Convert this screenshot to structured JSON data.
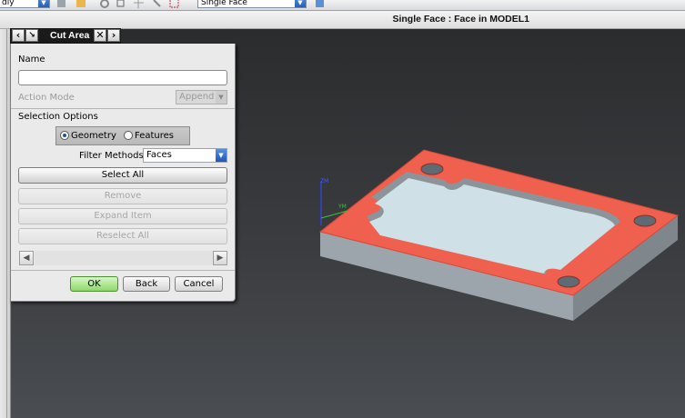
{
  "toolbar": {
    "left_combo_text": "dly",
    "selection_filter": "Single Face"
  },
  "viewport": {
    "title": "Single Face : Face in MODEL1"
  },
  "dialog": {
    "title": "Cut Area",
    "name_label": "Name",
    "name_value": "",
    "action_mode_label": "Action Mode",
    "action_mode_value": "Append",
    "selection_options_label": "Selection Options",
    "radio_geometry": "Geometry",
    "radio_features": "Features",
    "radio_selected": "Geometry",
    "filter_methods_label": "Filter Methods",
    "filter_methods_value": "Faces",
    "buttons": {
      "select_all": "Select All",
      "remove": "Remove",
      "expand_item": "Expand Item",
      "reselect_all": "Reselect All"
    },
    "footer": {
      "ok": "OK",
      "back": "Back",
      "cancel": "Cancel"
    }
  },
  "triad": {
    "zm": "ZM",
    "ym": "YM"
  },
  "colors": {
    "highlight": "#f0604f",
    "part_side": "#9fa8ae",
    "pocket_floor": "#cfe1e6",
    "ok_button": "#8fd86b"
  }
}
